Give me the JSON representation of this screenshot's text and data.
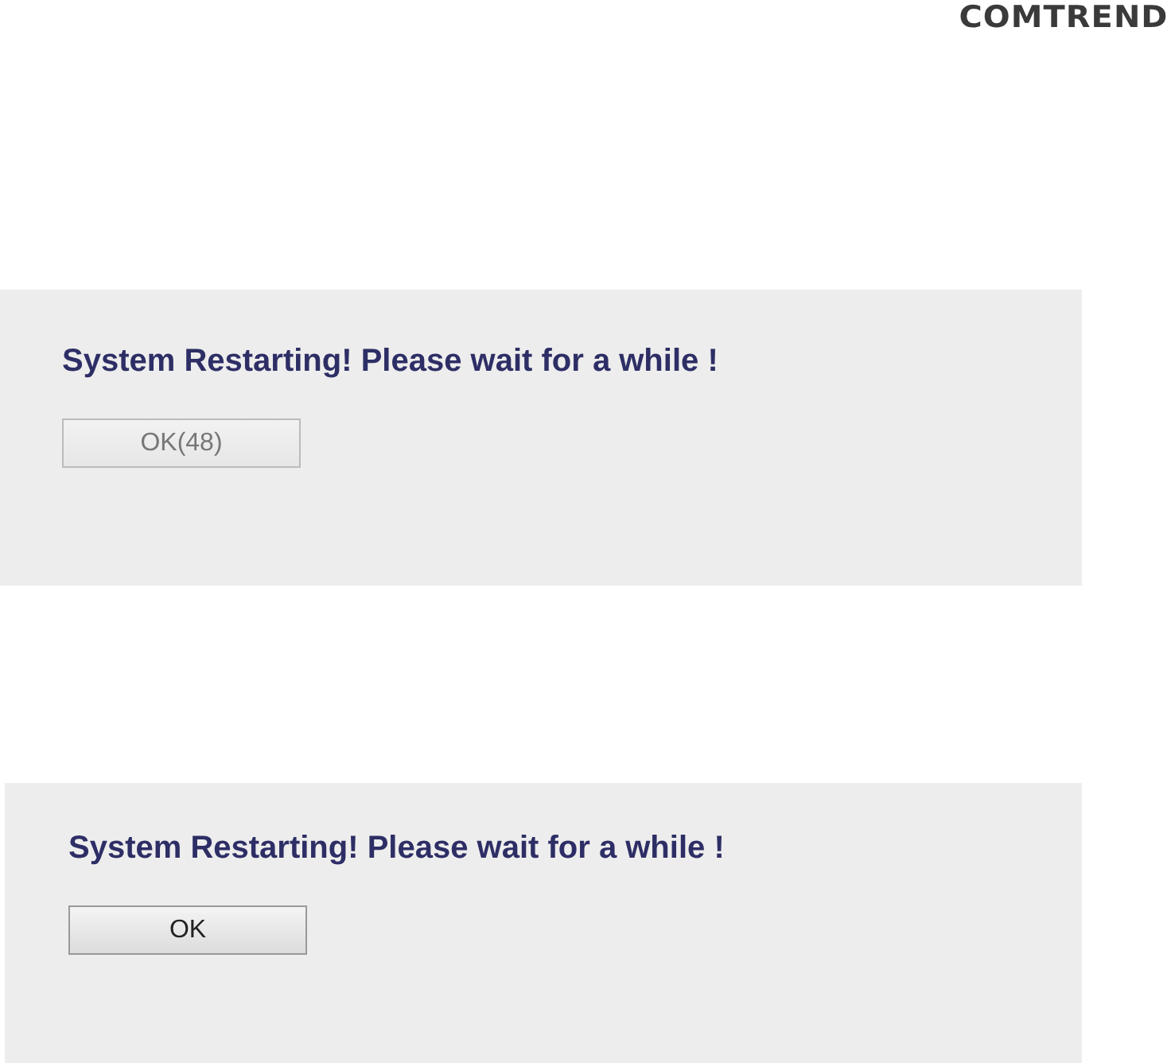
{
  "logo": {
    "text": "COMTREND"
  },
  "panels": [
    {
      "message": "System Restarting! Please wait for a while !",
      "button": {
        "label": "OK(48)",
        "disabled": true
      }
    },
    {
      "message": "System Restarting! Please wait for a while !",
      "button": {
        "label": "OK",
        "disabled": false
      }
    }
  ]
}
